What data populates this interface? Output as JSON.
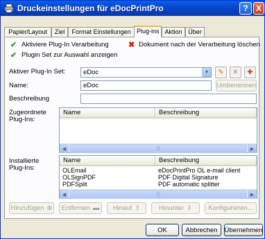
{
  "window": {
    "title": "Druckeinstellungen für eDocPrintPro",
    "help_label": "?",
    "close_label": "X"
  },
  "tabs": [
    {
      "label": "Papier/Layout"
    },
    {
      "label": "Ziel"
    },
    {
      "label": "Format Einstellungen"
    },
    {
      "label": "Plug-ins",
      "active": true
    },
    {
      "label": "Aktion"
    },
    {
      "label": "Über"
    }
  ],
  "options": {
    "activate_processing": "Aktiviere Plug-In Verarbeitung",
    "delete_document": "Dokument nach der Verarbeitung löschen",
    "show_plugin_set": "Plugin Set zur Auswahl anzeigen"
  },
  "form": {
    "active_set_label": "Aktiver Plug-In Set:",
    "active_set_value": "eDoc",
    "name_label": "Name:",
    "name_value": "eDoc",
    "rename_button": "Umbenennen",
    "description_label": "Beschreibung",
    "description_value": ""
  },
  "assigned": {
    "label_line1": "Zugeordnete",
    "label_line2": "Plug-Ins:",
    "columns": [
      "Name",
      "Beschreibung"
    ],
    "rows": []
  },
  "installed": {
    "label_line1": "Installierte",
    "label_line2": "Plug-Ins:",
    "columns": [
      "Name",
      "Beschreibung"
    ],
    "rows": [
      {
        "name": "OLEmail",
        "desc": "eDocPrintPro OL e-mail client"
      },
      {
        "name": "OLSignPDF",
        "desc": "PDF Digital Signature"
      },
      {
        "name": "PDFSplit",
        "desc": "PDF automatic splitter"
      }
    ]
  },
  "actions": {
    "add": "Hinzufügen",
    "remove": "Entfernen",
    "up": "Hinauf",
    "down": "Hinunter",
    "configure": "Konfigurieren..."
  },
  "footer": {
    "ok": "OK",
    "cancel": "Abbrechen",
    "apply": "Übernehmen"
  },
  "colors": {
    "titlebar": "#0a5fe8",
    "active_tab_accent": "#f7b43b",
    "check": "#2e9a2e",
    "delete": "#cc2200"
  }
}
